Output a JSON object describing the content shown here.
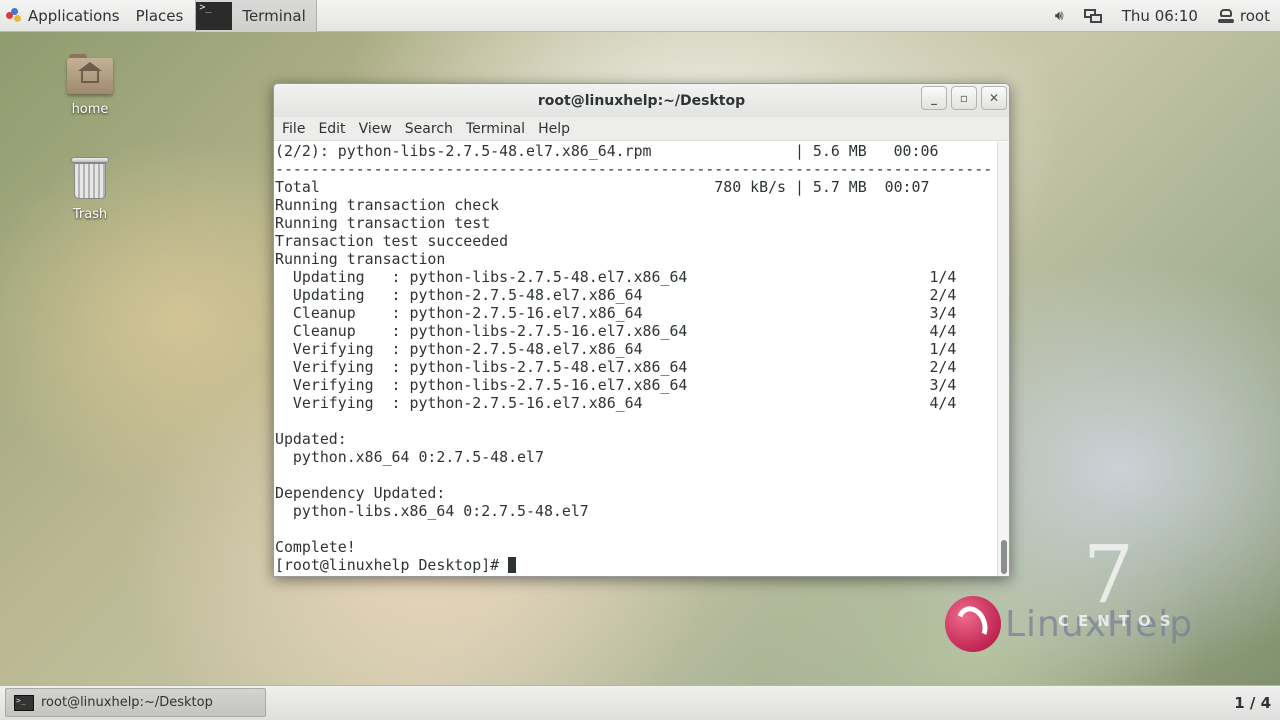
{
  "top_panel": {
    "applications_label": "Applications",
    "places_label": "Places",
    "terminal_label": "Terminal",
    "terminal_icon_glyph": ">_",
    "clock": "Thu 06:10",
    "user": "root"
  },
  "desktop": {
    "icons": [
      {
        "label": "home"
      },
      {
        "label": "Trash"
      }
    ]
  },
  "terminal_window": {
    "title": "root@linuxhelp:~/Desktop",
    "menu": [
      "File",
      "Edit",
      "View",
      "Search",
      "Terminal",
      "Help"
    ],
    "lines": [
      "(2/2): python-libs-2.7.5-48.el7.x86_64.rpm                | 5.6 MB   00:06",
      "--------------------------------------------------------------------------------",
      "Total                                            780 kB/s | 5.7 MB  00:07",
      "Running transaction check",
      "Running transaction test",
      "Transaction test succeeded",
      "Running transaction",
      "  Updating   : python-libs-2.7.5-48.el7.x86_64                           1/4",
      "  Updating   : python-2.7.5-48.el7.x86_64                                2/4",
      "  Cleanup    : python-2.7.5-16.el7.x86_64                                3/4",
      "  Cleanup    : python-libs-2.7.5-16.el7.x86_64                           4/4",
      "  Verifying  : python-2.7.5-48.el7.x86_64                                1/4",
      "  Verifying  : python-libs-2.7.5-48.el7.x86_64                           2/4",
      "  Verifying  : python-libs-2.7.5-16.el7.x86_64                           3/4",
      "  Verifying  : python-2.7.5-16.el7.x86_64                                4/4",
      "",
      "Updated:",
      "  python.x86_64 0:2.7.5-48.el7",
      "",
      "Dependency Updated:",
      "  python-libs.x86_64 0:2.7.5-48.el7",
      "",
      "Complete!"
    ],
    "prompt": "[root@linuxhelp Desktop]# "
  },
  "watermark": {
    "version": "7",
    "distro": "CENTOS",
    "brand": "LinuxHelp"
  },
  "bottom_panel": {
    "task_label": "root@linuxhelp:~/Desktop",
    "workspace": "1 / 4"
  },
  "colors": {
    "terminal_text": "#2e3436",
    "panel_bg": "#ededeb",
    "brand_pink": "#c42a57"
  }
}
